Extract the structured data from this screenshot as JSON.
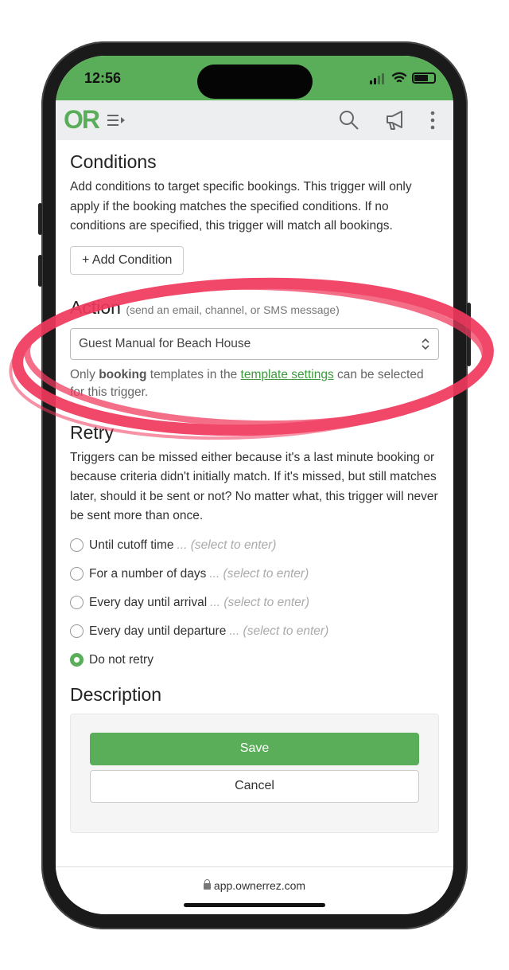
{
  "status_bar": {
    "time": "12:56"
  },
  "app_bar": {
    "logo": "OR",
    "icons": [
      "menu-expand-icon",
      "search-icon",
      "megaphone-icon",
      "more-vertical-icon"
    ]
  },
  "conditions": {
    "title": "Conditions",
    "description": "Add conditions to target specific bookings. This trigger will only apply if the booking matches the specified conditions. If no conditions are specified, this trigger will match all bookings.",
    "add_button": "Add Condition"
  },
  "action": {
    "title": "Action",
    "subtitle": "(send an email, channel, or SMS message)",
    "selected": "Guest Manual for Beach House",
    "note_prefix": "Only ",
    "note_bold": "booking",
    "note_mid": " templates in the ",
    "note_link": "template settings",
    "note_suffix": " can be selected for this trigger."
  },
  "retry": {
    "title": "Retry",
    "description": "Triggers can be missed either because it's a last minute booking or because criteria didn't initially match. If it's missed, but still matches later, should it be sent or not? No matter what, this trigger will never be sent more than once.",
    "options": [
      {
        "label": "Until cutoff time",
        "hint": "... (select to enter)",
        "selected": false
      },
      {
        "label": "For a number of days",
        "hint": "... (select to enter)",
        "selected": false
      },
      {
        "label": "Every day until arrival",
        "hint": "... (select to enter)",
        "selected": false
      },
      {
        "label": "Every day until departure",
        "hint": "... (select to enter)",
        "selected": false
      },
      {
        "label": "Do not retry",
        "hint": "",
        "selected": true
      }
    ]
  },
  "description": {
    "title": "Description"
  },
  "buttons": {
    "save": "Save",
    "cancel": "Cancel"
  },
  "url_bar": {
    "url": "app.ownerrez.com"
  },
  "colors": {
    "brand": "#5aae5a",
    "annotation": "#f0395e"
  }
}
